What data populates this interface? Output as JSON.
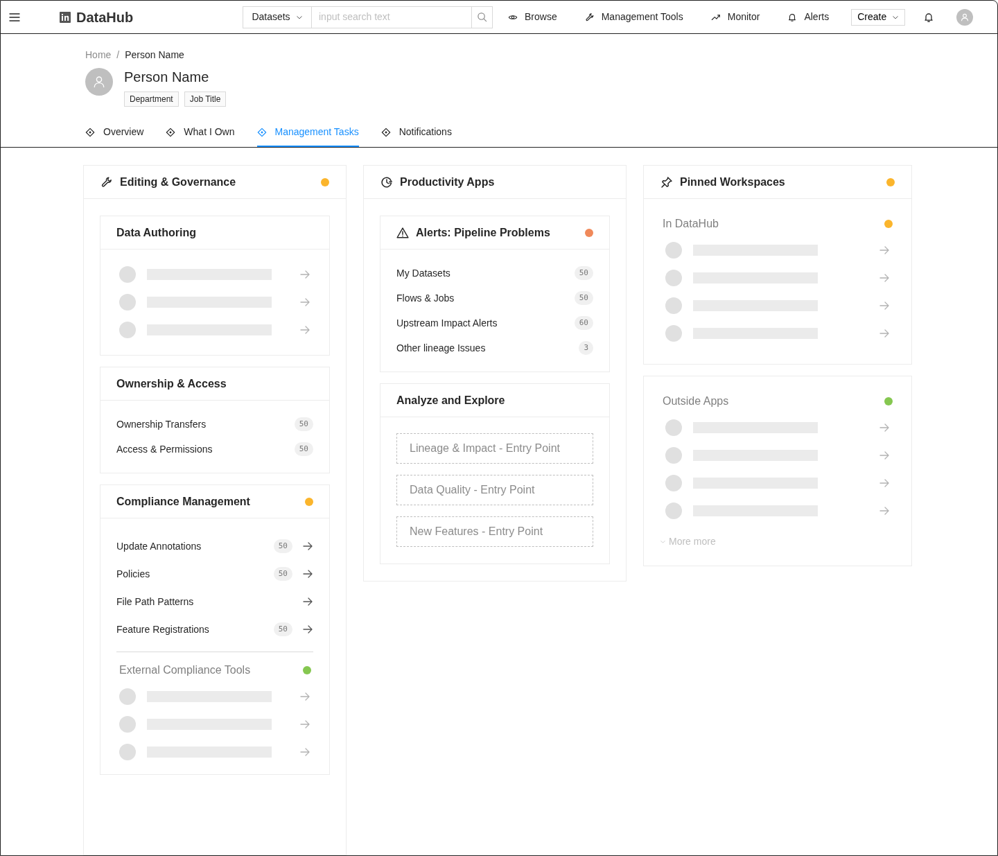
{
  "topbar": {
    "brand": "DataHub",
    "search_scope": "Datasets",
    "search_placeholder": "input search text",
    "links": [
      {
        "label": "Browse"
      },
      {
        "label": "Management Tools"
      },
      {
        "label": "Monitor"
      },
      {
        "label": "Alerts"
      }
    ],
    "create": "Create"
  },
  "breadcrumb": {
    "separator": "/",
    "items": [
      "Home",
      "Person Name"
    ]
  },
  "profile": {
    "name": "Person Name",
    "tags": [
      "Department",
      "Job Title"
    ]
  },
  "tabs": [
    {
      "label": "Overview",
      "selected": false
    },
    {
      "label": "What I Own",
      "selected": false
    },
    {
      "label": "Management Tasks",
      "selected": true
    },
    {
      "label": "Notifications",
      "selected": false
    }
  ],
  "columns": [
    {
      "panels": [
        {
          "header": {
            "title": "Editing & Governance",
            "color": "#fbb52c"
          },
          "blocks": [
            {
              "kind": "card",
              "title": "Data Authoring",
              "placeholder_rows": [
                {
                  "kind": "loading"
                },
                {
                  "kind": "loading"
                },
                {
                  "kind": "loading"
                }
              ]
            },
            {
              "kind": "card",
              "title": "Ownership & Access",
              "items": [
                {
                  "label": "Ownership Transfers",
                  "count": "50",
                  "arrow": false
                },
                {
                  "label": "Access & Permissions",
                  "count": "50",
                  "arrow": false
                }
              ]
            },
            {
              "kind": "card",
              "title": "Compliance Management",
              "color": "#fbb52c",
              "items": [
                {
                  "label": "Update Annotations",
                  "count": "50",
                  "arrow": true
                },
                {
                  "label": "Policies",
                  "count": "50",
                  "arrow": true
                },
                {
                  "label": "File Path Patterns",
                  "arrow": true
                },
                {
                  "label": "Feature Registrations",
                  "count": "50",
                  "arrow": true
                }
              ],
              "subgroup": {
                "title": "External Compliance Tools",
                "color": "#85c750",
                "placeholder_rows": [
                  {
                    "kind": "loading"
                  },
                  {
                    "kind": "loading"
                  },
                  {
                    "kind": "loading"
                  }
                ]
              }
            }
          ]
        }
      ]
    },
    {
      "panels": [
        {
          "header": {
            "title": "Productivity Apps"
          },
          "blocks": [
            {
              "kind": "alert_card",
              "title": "Alerts: Pipeline Problems",
              "color": "#f0895a",
              "items": [
                {
                  "label": "My Datasets",
                  "count": "50",
                  "arrow": false
                },
                {
                  "label": "Flows & Jobs",
                  "count": "50",
                  "arrow": false
                },
                {
                  "label": "Upstream Impact Alerts",
                  "count": "60",
                  "arrow": false
                },
                {
                  "label": "Other lineage Issues",
                  "count": "3",
                  "arrow": false
                }
              ]
            },
            {
              "kind": "card",
              "title": "Analyze and Explore",
              "entries": [
                "Lineage & Impact - Entry Point",
                "Data Quality - Entry Point",
                "New Features - Entry Point"
              ]
            }
          ]
        }
      ]
    },
    {
      "panels": [
        {
          "header": {
            "title": "Pinned Workspaces",
            "color": "#fbb52c"
          },
          "blocks": [
            {
              "kind": "group",
              "title": "In DataHub",
              "color": "#fbb52c",
              "placeholder_rows": [
                {
                  "kind": "loading"
                },
                {
                  "kind": "loading"
                },
                {
                  "kind": "loading"
                },
                {
                  "kind": "loading"
                }
              ]
            }
          ]
        },
        {
          "blocks": [
            {
              "kind": "group",
              "title": "Outside Apps",
              "color": "#85c750",
              "placeholder_rows": [
                {
                  "kind": "loading"
                },
                {
                  "kind": "loading"
                },
                {
                  "kind": "loading"
                },
                {
                  "kind": "loading"
                }
              ],
              "more": "More more"
            }
          ]
        }
      ]
    }
  ]
}
